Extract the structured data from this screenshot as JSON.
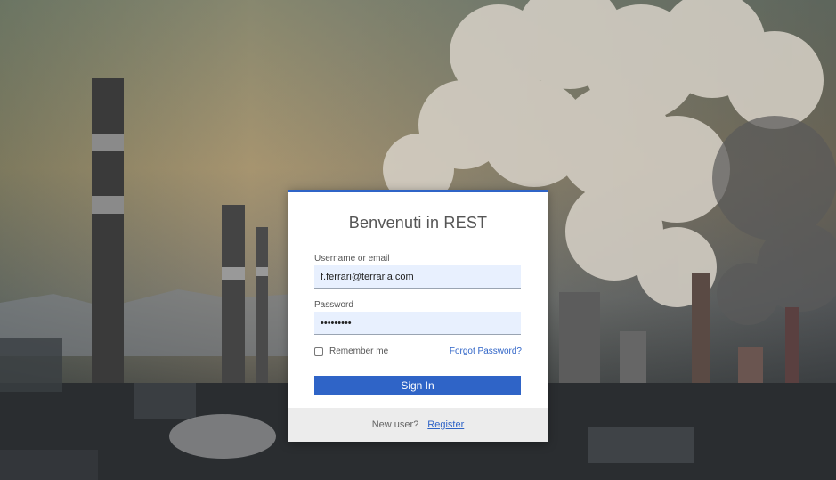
{
  "login": {
    "title": "Benvenuti in REST",
    "username_label": "Username or email",
    "username_value": "f.ferrari@terraria.com",
    "password_label": "Password",
    "password_value": "•••••••••",
    "remember_label": "Remember me",
    "remember_checked": false,
    "forgot_label": "Forgot Password?",
    "signin_label": "Sign In",
    "new_user_label": "New user?",
    "register_label": "Register"
  },
  "colors": {
    "accent": "#2f64c7",
    "field_bg": "#e8f0fe",
    "footer_bg": "#ececec"
  }
}
